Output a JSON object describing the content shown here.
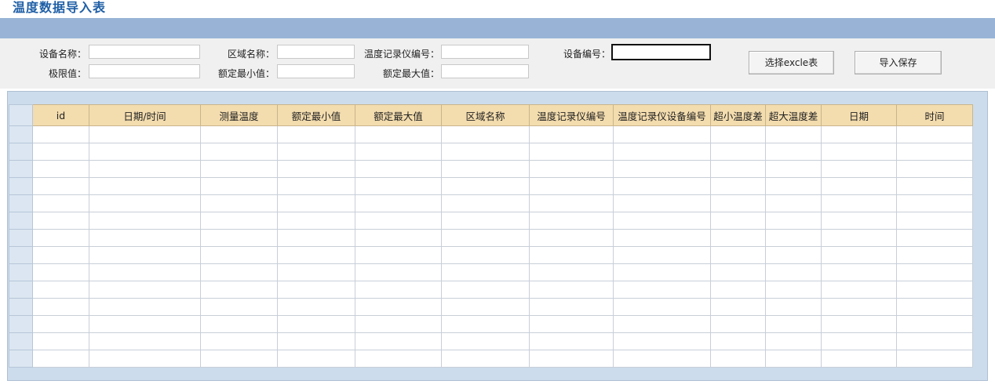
{
  "page": {
    "title": "温度数据导入表"
  },
  "form": {
    "device_name": {
      "label": "设备名称：",
      "value": ""
    },
    "area_name": {
      "label": "区域名称：",
      "value": ""
    },
    "recorder_no": {
      "label": "温度记录仪编号：",
      "value": ""
    },
    "device_no": {
      "label": "设备编号：",
      "value": ""
    },
    "limit_value": {
      "label": "极限值：",
      "value": ""
    },
    "rated_min": {
      "label": "额定最小值：",
      "value": ""
    },
    "rated_max": {
      "label": "额定最大值：",
      "value": ""
    }
  },
  "buttons": {
    "select_excel": "选择excle表",
    "import_save": "导入保存"
  },
  "grid": {
    "columns": [
      "id",
      "日期/时间",
      "测量温度",
      "额定最小值",
      "额定最大值",
      "区域名称",
      "温度记录仪编号",
      "温度记录仪设备编号",
      "超小温度差",
      "超大温度差",
      "日期",
      "时间"
    ],
    "rows": [
      [
        "",
        "",
        "",
        "",
        "",
        "",
        "",
        "",
        "",
        "",
        "",
        ""
      ],
      [
        "",
        "",
        "",
        "",
        "",
        "",
        "",
        "",
        "",
        "",
        "",
        ""
      ],
      [
        "",
        "",
        "",
        "",
        "",
        "",
        "",
        "",
        "",
        "",
        "",
        ""
      ],
      [
        "",
        "",
        "",
        "",
        "",
        "",
        "",
        "",
        "",
        "",
        "",
        ""
      ],
      [
        "",
        "",
        "",
        "",
        "",
        "",
        "",
        "",
        "",
        "",
        "",
        ""
      ],
      [
        "",
        "",
        "",
        "",
        "",
        "",
        "",
        "",
        "",
        "",
        "",
        ""
      ],
      [
        "",
        "",
        "",
        "",
        "",
        "",
        "",
        "",
        "",
        "",
        "",
        ""
      ],
      [
        "",
        "",
        "",
        "",
        "",
        "",
        "",
        "",
        "",
        "",
        "",
        ""
      ],
      [
        "",
        "",
        "",
        "",
        "",
        "",
        "",
        "",
        "",
        "",
        "",
        ""
      ],
      [
        "",
        "",
        "",
        "",
        "",
        "",
        "",
        "",
        "",
        "",
        "",
        ""
      ],
      [
        "",
        "",
        "",
        "",
        "",
        "",
        "",
        "",
        "",
        "",
        "",
        ""
      ],
      [
        "",
        "",
        "",
        "",
        "",
        "",
        "",
        "",
        "",
        "",
        "",
        ""
      ],
      [
        "",
        "",
        "",
        "",
        "",
        "",
        "",
        "",
        "",
        "",
        "",
        ""
      ],
      [
        "",
        "",
        "",
        "",
        "",
        "",
        "",
        "",
        "",
        "",
        "",
        ""
      ]
    ]
  },
  "colors": {
    "title": "#1f5fa6",
    "toolbar": "#98b3d6",
    "header": "#f3dcae",
    "grid_panel": "#ccdcec"
  }
}
